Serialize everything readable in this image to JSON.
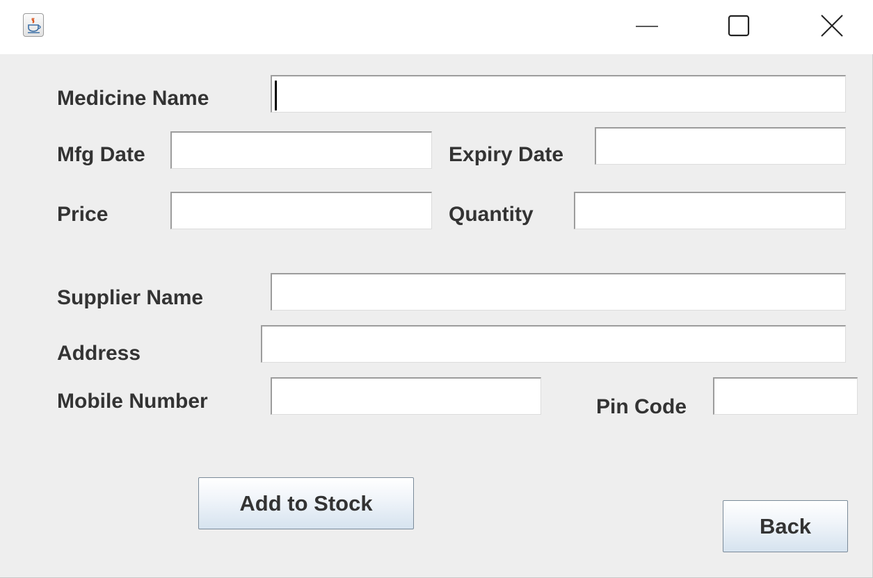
{
  "window": {
    "title": "",
    "icon": "java-cup-icon",
    "controls": {
      "minimize": "minimize-icon",
      "maximize": "maximize-icon",
      "close": "close-icon"
    }
  },
  "form": {
    "medicine_name": {
      "label": "Medicine Name",
      "value": ""
    },
    "mfg_date": {
      "label": "Mfg Date",
      "value": ""
    },
    "expiry_date": {
      "label": "Expiry Date",
      "value": ""
    },
    "price": {
      "label": "Price",
      "value": ""
    },
    "quantity": {
      "label": "Quantity",
      "value": ""
    },
    "supplier_name": {
      "label": "Supplier Name",
      "value": ""
    },
    "address": {
      "label": "Address",
      "value": ""
    },
    "mobile_number": {
      "label": "Mobile Number",
      "value": ""
    },
    "pin_code": {
      "label": "Pin Code",
      "value": ""
    }
  },
  "buttons": {
    "add_to_stock": "Add to Stock",
    "back": "Back"
  },
  "colors": {
    "background": "#eeeeee",
    "titlebar": "#ffffff",
    "label_text": "#333333",
    "button_gradient_bottom": "#d6e3ef"
  }
}
